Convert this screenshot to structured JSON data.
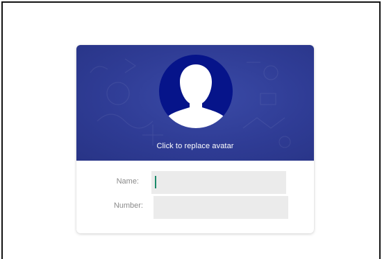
{
  "profile_card": {
    "avatar_caption": "Click to replace avatar",
    "fields": [
      {
        "label": "Name:",
        "value": ""
      },
      {
        "label": "Number:",
        "value": ""
      }
    ]
  },
  "colors": {
    "header_bg": "#2f3c95",
    "avatar_bg": "#06148a",
    "field_bg": "#ebebeb",
    "caret": "#1a8a6a",
    "label_text": "#8a8a8a"
  },
  "icons": {
    "avatar": "person-silhouette-icon"
  }
}
